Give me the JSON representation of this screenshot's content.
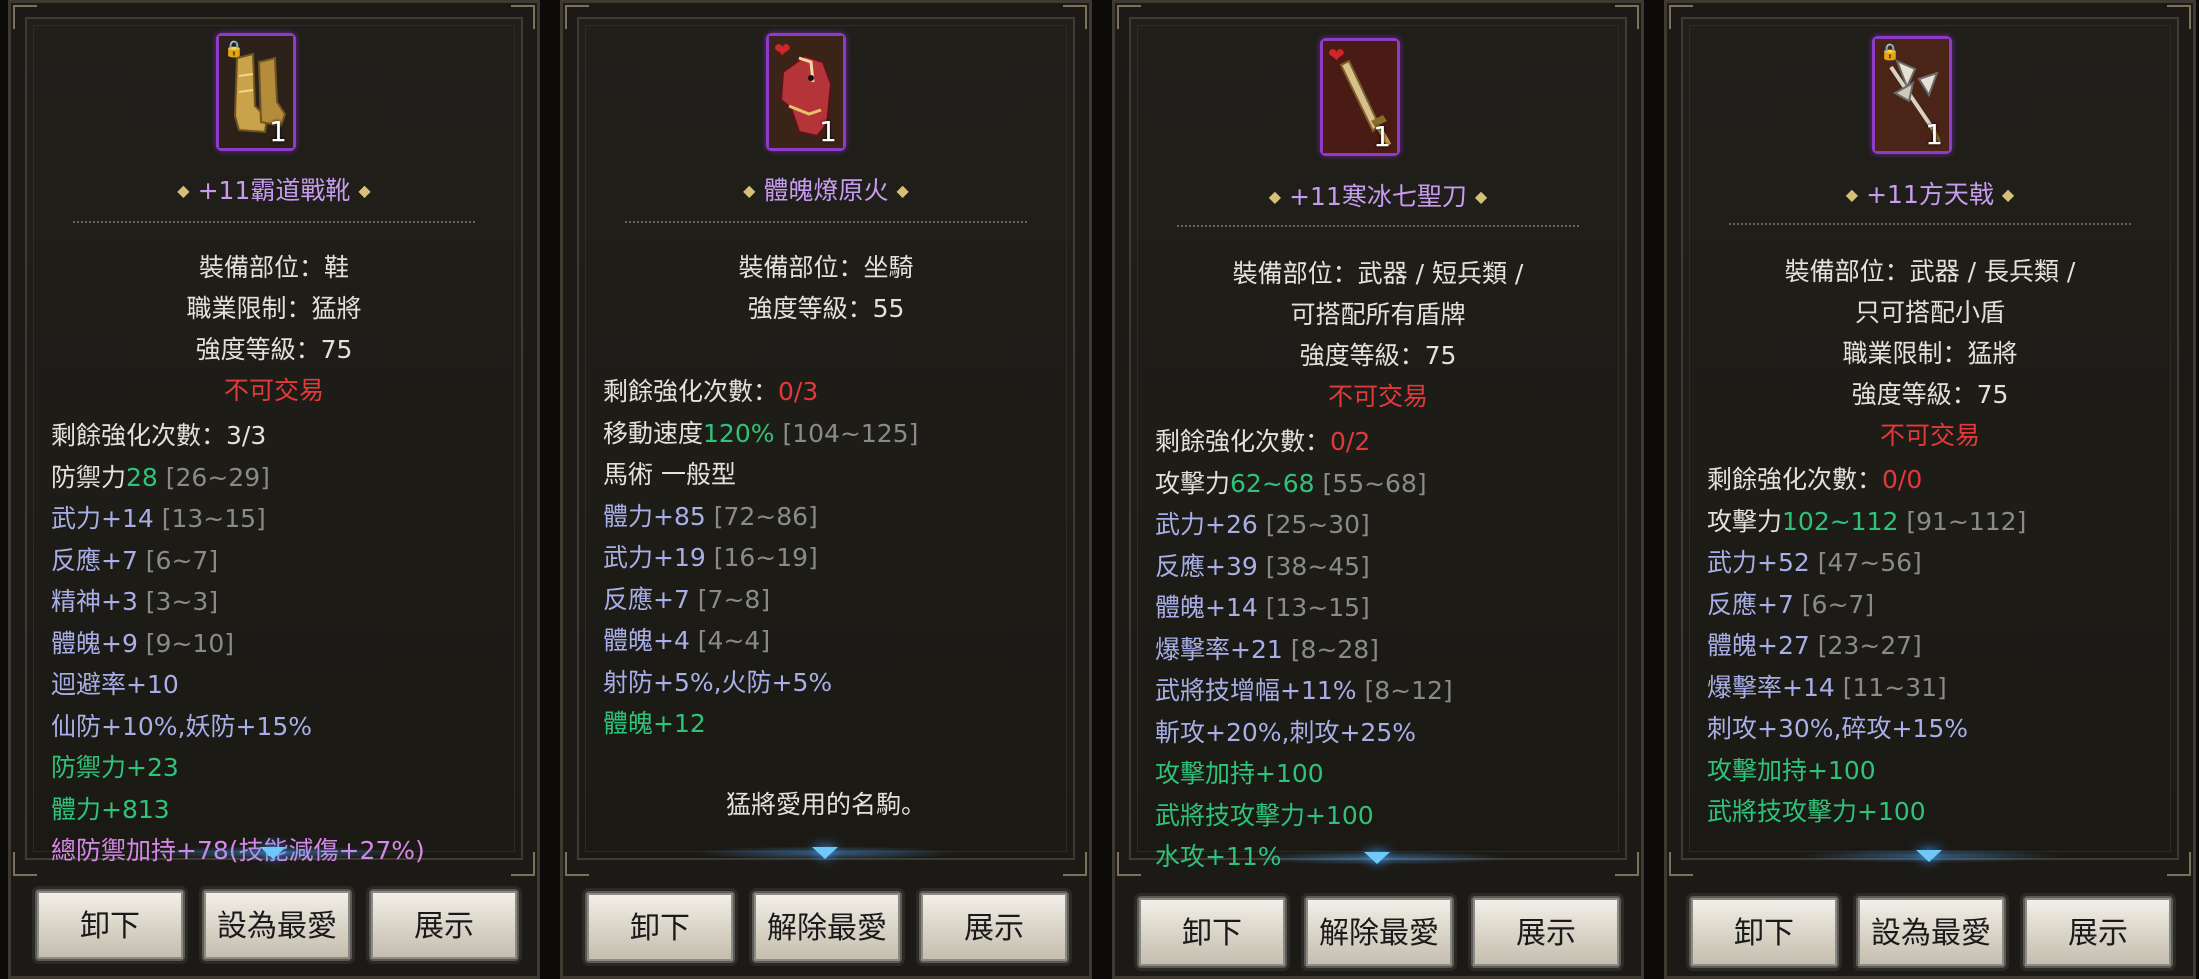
{
  "panels": [
    {
      "name": "+11霸道戰靴",
      "count": "1",
      "badge": "lock",
      "center": [
        "裝備部位：鞋",
        "職業限制：猛將",
        "強度等級：75"
      ],
      "trade": "不可交易",
      "enh_label": "剩餘強化次數：",
      "enh_value": "3/3",
      "lines": [
        [
          {
            "t": "防禦力",
            "c": "w"
          },
          {
            "t": "28",
            "c": "g"
          },
          {
            "t": " [26~29]",
            "c": "gr"
          }
        ],
        [
          {
            "t": "武力+14",
            "c": "b"
          },
          {
            "t": " [13~15]",
            "c": "gr"
          }
        ],
        [
          {
            "t": "反應+7",
            "c": "b"
          },
          {
            "t": " [6~7]",
            "c": "gr"
          }
        ],
        [
          {
            "t": "精神+3",
            "c": "b"
          },
          {
            "t": " [3~3]",
            "c": "gr"
          }
        ],
        [
          {
            "t": "體魄+9",
            "c": "b"
          },
          {
            "t": " [9~10]",
            "c": "gr"
          }
        ],
        [
          {
            "t": "迴避率+10",
            "c": "b"
          }
        ],
        [
          {
            "t": "仙防+10%,妖防+15%",
            "c": "b"
          }
        ],
        [
          {
            "t": "防禦力+23",
            "c": "g"
          }
        ],
        [
          {
            "t": "體力+813",
            "c": "g"
          }
        ],
        [
          {
            "t": "總防禦加持+78(技能減傷+27%)",
            "c": "p"
          }
        ]
      ],
      "buttons": [
        "卸下",
        "設為最愛",
        "展示"
      ]
    },
    {
      "name": "體魄燎原火",
      "count": "1",
      "badge": "heart",
      "center": [
        "裝備部位：坐騎",
        "強度等級：55"
      ],
      "trade": "",
      "enh_label": "剩餘強化次數：",
      "enh_value": "0/3",
      "lines": [
        [
          {
            "t": "移動速度",
            "c": "w"
          },
          {
            "t": "120%",
            "c": "g"
          },
          {
            "t": " [104~125]",
            "c": "gr"
          }
        ],
        [
          {
            "t": "馬術 一般型",
            "c": "w"
          }
        ],
        [
          {
            "t": "體力+85",
            "c": "b"
          },
          {
            "t": " [72~86]",
            "c": "gr"
          }
        ],
        [
          {
            "t": "武力+19",
            "c": "b"
          },
          {
            "t": " [16~19]",
            "c": "gr"
          }
        ],
        [
          {
            "t": "反應+7",
            "c": "b"
          },
          {
            "t": " [7~8]",
            "c": "gr"
          }
        ],
        [
          {
            "t": "體魄+4",
            "c": "b"
          },
          {
            "t": " [4~4]",
            "c": "gr"
          }
        ],
        [
          {
            "t": "射防+5%,火防+5%",
            "c": "b"
          }
        ],
        [
          {
            "t": "體魄+12",
            "c": "g"
          }
        ]
      ],
      "description": "猛將愛用的名駒。",
      "buttons": [
        "卸下",
        "解除最愛",
        "展示"
      ]
    },
    {
      "name": "+11寒冰七聖刀",
      "count": "1",
      "badge": "heart",
      "center": [
        "裝備部位：武器 / 短兵類 /",
        "可搭配所有盾牌",
        "強度等級：75"
      ],
      "trade": "不可交易",
      "enh_label": "剩餘強化次數：",
      "enh_value": "0/2",
      "lines": [
        [
          {
            "t": "攻擊力",
            "c": "w"
          },
          {
            "t": "62~68",
            "c": "g"
          },
          {
            "t": " [55~68]",
            "c": "gr"
          }
        ],
        [
          {
            "t": "武力+26",
            "c": "b"
          },
          {
            "t": " [25~30]",
            "c": "gr"
          }
        ],
        [
          {
            "t": "反應+39",
            "c": "b"
          },
          {
            "t": " [38~45]",
            "c": "gr"
          }
        ],
        [
          {
            "t": "體魄+14",
            "c": "b"
          },
          {
            "t": " [13~15]",
            "c": "gr"
          }
        ],
        [
          {
            "t": "爆擊率+21",
            "c": "b"
          },
          {
            "t": " [8~28]",
            "c": "gr"
          }
        ],
        [
          {
            "t": "武將技增幅+11%",
            "c": "b"
          },
          {
            "t": " [8~12]",
            "c": "gr"
          }
        ],
        [
          {
            "t": "斬攻+20%,刺攻+25%",
            "c": "b"
          }
        ],
        [
          {
            "t": "攻擊加持+100",
            "c": "g"
          }
        ],
        [
          {
            "t": "武將技攻擊力+100",
            "c": "g"
          }
        ],
        [
          {
            "t": "水攻+11%",
            "c": "g"
          }
        ]
      ],
      "buttons": [
        "卸下",
        "解除最愛",
        "展示"
      ]
    },
    {
      "name": "+11方天戟",
      "count": "1",
      "badge": "lock",
      "center": [
        "裝備部位：武器 / 長兵類 /",
        "只可搭配小盾",
        "職業限制：猛將",
        "強度等級：75"
      ],
      "trade": "不可交易",
      "enh_label": "剩餘強化次數：",
      "enh_value": "0/0",
      "lines": [
        [
          {
            "t": "攻擊力",
            "c": "w"
          },
          {
            "t": "102~112",
            "c": "g"
          },
          {
            "t": " [91~112]",
            "c": "gr"
          }
        ],
        [
          {
            "t": "武力+52",
            "c": "b"
          },
          {
            "t": " [47~56]",
            "c": "gr"
          }
        ],
        [
          {
            "t": "反應+7",
            "c": "b"
          },
          {
            "t": " [6~7]",
            "c": "gr"
          }
        ],
        [
          {
            "t": "體魄+27",
            "c": "b"
          },
          {
            "t": " [23~27]",
            "c": "gr"
          }
        ],
        [
          {
            "t": "爆擊率+14",
            "c": "b"
          },
          {
            "t": " [11~31]",
            "c": "gr"
          }
        ],
        [
          {
            "t": "刺攻+30%,碎攻+15%",
            "c": "b"
          }
        ],
        [
          {
            "t": "攻擊加持+100",
            "c": "g"
          }
        ],
        [
          {
            "t": "武將技攻擊力+100",
            "c": "g"
          }
        ]
      ],
      "buttons": [
        "卸下",
        "設為最愛",
        "展示"
      ]
    }
  ]
}
